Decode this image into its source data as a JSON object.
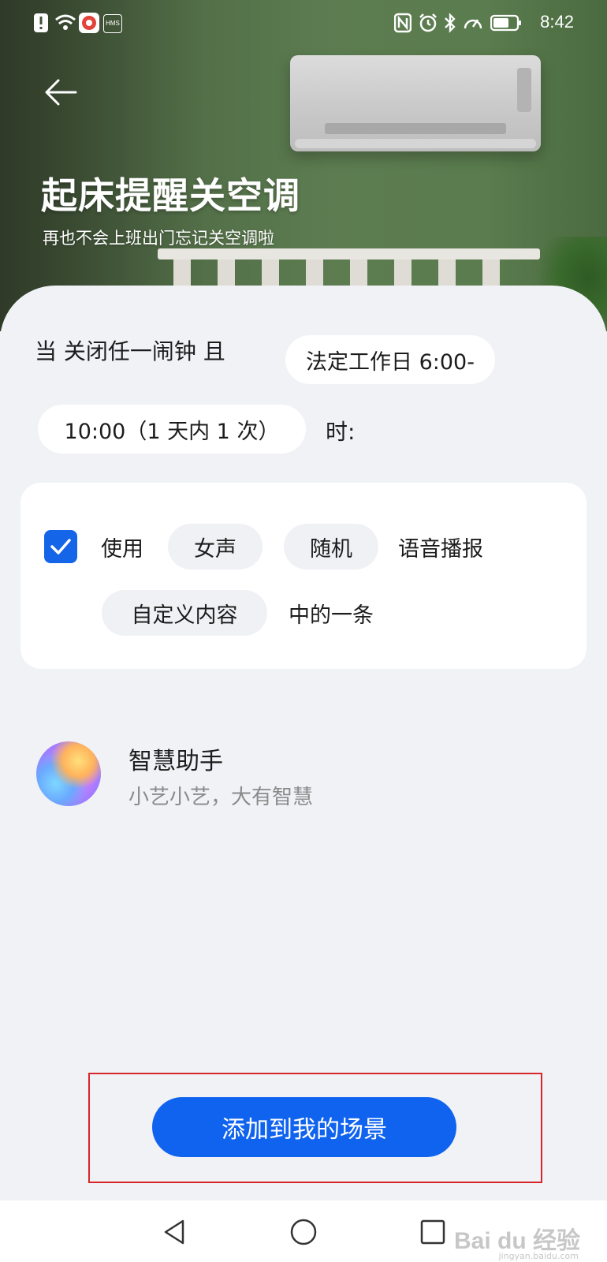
{
  "status_bar": {
    "time": "8:42",
    "left_icons": [
      "alert-icon",
      "wifi-icon",
      "app-notification-icon",
      "hms-icon"
    ],
    "hms_label": "HMS",
    "right_icons": [
      "nfc-icon",
      "alarm-icon",
      "bluetooth-icon",
      "speed-icon",
      "battery-icon"
    ]
  },
  "header": {
    "title": "起床提醒关空调",
    "subtitle": "再也不会上班出门忘记关空调啦"
  },
  "condition": {
    "prefix": "当 关闭任一闹钟 且",
    "schedule_part1": "法定工作日 6:00-",
    "schedule_part2": "10:00（1 天内 1 次）",
    "suffix": "时:"
  },
  "action": {
    "checked": true,
    "use_label": "使用",
    "voice_option": "女声",
    "mode_option": "随机",
    "announce_label": "语音播报",
    "content_option": "自定义内容",
    "tail_label": "中的一条"
  },
  "assistant": {
    "name": "智慧助手",
    "tagline": "小艺小艺，大有智慧"
  },
  "cta": {
    "label": "添加到我的场景",
    "color": "#1063ef"
  },
  "watermark": {
    "brand": "Bai du 经验",
    "url": "jingyan.baidu.com"
  },
  "nav": [
    "back-nav-icon",
    "home-nav-icon",
    "recents-nav-icon"
  ]
}
